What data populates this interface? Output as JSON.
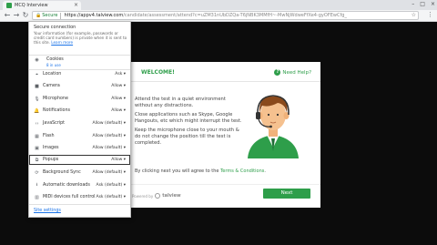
{
  "browser": {
    "tab_title": "MCQ Interview",
    "secure_label": "Secure",
    "url_host": "https://appv4.talview.com",
    "url_path": "/candidate/assessment/attend?c=uZM31nUbDZQa-T6jNBK3MMfH~-MwNjWdweFfXe4-gyOFEwCfg_",
    "icons": {
      "back": "back-arrow-icon",
      "forward": "forward-arrow-icon",
      "reload": "reload-icon",
      "star": "star-icon",
      "menu": "menu-dots-icon"
    }
  },
  "popup": {
    "security_title": "Secure connection",
    "security_desc": "Your information (for example, passwords or credit card numbers) is private when it is sent to this site.",
    "learn_more": "Learn more",
    "cookies_label": "Cookies",
    "cookies_in_use": "8 in use",
    "permissions": [
      {
        "icon": "location-icon",
        "glyph": "⌖",
        "label": "Location",
        "value": "Ask ▾"
      },
      {
        "icon": "camera-icon",
        "glyph": "■",
        "label": "Camera",
        "value": "Allow ▾"
      },
      {
        "icon": "microphone-icon",
        "glyph": "🎙",
        "label": "Microphone",
        "value": "Allow ▾"
      },
      {
        "icon": "notifications-icon",
        "glyph": "🔔",
        "label": "Notifications",
        "value": "Allow ▾"
      },
      {
        "icon": "javascript-icon",
        "glyph": "‹›",
        "label": "JavaScript",
        "value": "Allow (default) ▾"
      },
      {
        "icon": "flash-icon",
        "glyph": "▦",
        "label": "Flash",
        "value": "Allow (default) ▾"
      },
      {
        "icon": "images-icon",
        "glyph": "▣",
        "label": "Images",
        "value": "Allow (default) ▾"
      },
      {
        "icon": "popups-icon",
        "glyph": "⧉",
        "label": "Popups",
        "value": "Allow ▾"
      },
      {
        "icon": "background-sync-icon",
        "glyph": "⟳",
        "label": "Background Sync",
        "value": "Allow (default) ▾"
      },
      {
        "icon": "automatic-downloads-icon",
        "glyph": "⭳",
        "label": "Automatic downloads",
        "value": "Ask (default) ▾"
      },
      {
        "icon": "midi-icon",
        "glyph": "▥",
        "label": "MIDI devices full control",
        "value": "Ask (default) ▾"
      }
    ],
    "site_settings": "Site settings"
  },
  "page": {
    "welcome": "WELCOME!",
    "need_help": "Need Help?",
    "instructions": [
      "Attend the test in a quiet environment without any distractions.",
      "Close applications such as Skype, Google Hangouts, etc which might interrupt the test.",
      "Keep the microphone close to your mouth & do not change the position till the test is completed."
    ],
    "terms_prefix": "By clicking next you will agree to the ",
    "terms_link": "Terms & Conditions",
    "terms_suffix": ".",
    "powered_by": "Powered by",
    "brand": "talview",
    "next_button": "Next",
    "accent_color": "#2e9e4a"
  }
}
